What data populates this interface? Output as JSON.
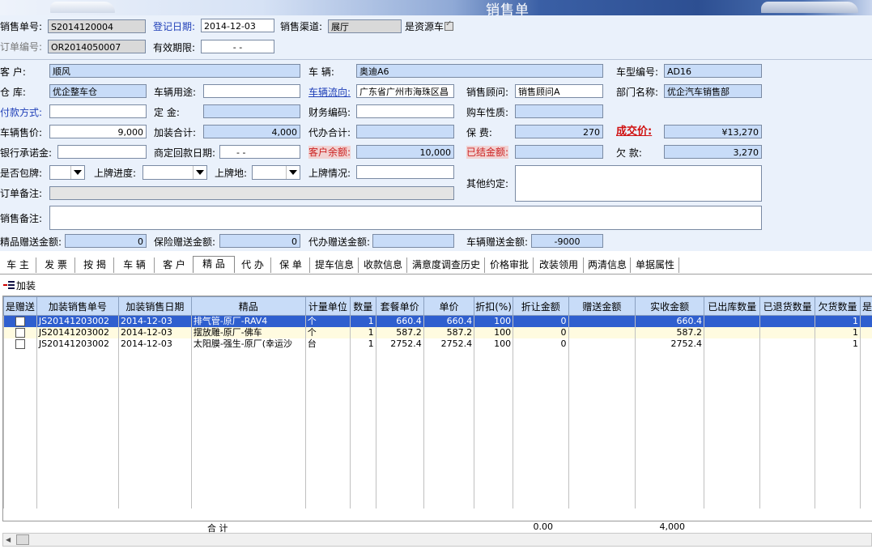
{
  "window": {
    "title": "销售单"
  },
  "header": {
    "sale_no_label": "销售单号:",
    "sale_no": "S2014120004",
    "reg_date_label": "登记日期:",
    "reg_date": "2014-12-03",
    "channel_label": "销售渠道:",
    "channel": "展厅",
    "resource_car_label": "是资源车",
    "order_no_label": "订单编号:",
    "order_no": "OR2014050007",
    "valid_label": "有效期限:",
    "valid": "-  -"
  },
  "form": {
    "customer_label": "客    户:",
    "customer": "顺风",
    "vehicle_label": "车    辆:",
    "vehicle": "奥迪A6",
    "model_no_label": "车型编号:",
    "model_no": "AD16",
    "warehouse_label": "仓    库:",
    "warehouse": "优企整车仓",
    "usage_label": "车辆用途:",
    "usage": "",
    "flow_label": "车辆流向:",
    "flow": "广东省广州市海珠区昌",
    "consultant_label": "销售顾问:",
    "consultant": "销售顾问A",
    "dept_label": "部门名称:",
    "dept": "优企汽车销售部",
    "pay_label": "付款方式:",
    "pay": "",
    "deposit_label": "定    金:",
    "deposit": "",
    "fin_code_label": "财务编码:",
    "fin_code": "",
    "buy_nature_label": "购车性质:",
    "buy_nature": "",
    "price_label": "车辆售价:",
    "price": "9,000",
    "addon_total_label": "加装合计:",
    "addon_total": "4,000",
    "agent_total_label": "代办合计:",
    "agent_total": "",
    "insurance_label": "保    费:",
    "insurance": "270",
    "deal_price_label": "成交价:",
    "deal_price": "¥13,270",
    "bank_label": "银行承诺金:",
    "bank": "",
    "repay_date_label": "商定回款日期:",
    "repay_date": "-  -",
    "cust_balance_label": "客户余额:",
    "cust_balance": "10,000",
    "settled_label": "已结金额:",
    "settled": "",
    "owed_label": "欠    款:",
    "owed": "3,270",
    "plate_pkg_label": "是否包牌:",
    "plate_progress_label": "上牌进度:",
    "plate_place_label": "上牌地:",
    "plate_status_label": "上牌情况:",
    "plate_status": "",
    "other_label": "其他约定:",
    "other": "",
    "order_note_label": "订单备注:",
    "order_note": "",
    "sale_note_label": "销售备注:",
    "sale_note": "",
    "gift_goods_label": "精品赠送金额:",
    "gift_goods": "0",
    "gift_ins_label": "保险赠送金额:",
    "gift_ins": "0",
    "gift_agent_label": "代办赠送金额:",
    "gift_agent": "",
    "gift_car_label": "车辆赠送金额:",
    "gift_car": "-9000"
  },
  "tabs": [
    "车 主",
    "发 票",
    "按 揭",
    "车 辆",
    "客 户",
    "精 品",
    "代 办",
    "保 单",
    "提车信息",
    "收款信息",
    "满意度调查历史",
    "价格审批",
    "改装领用",
    "两清信息",
    "单据属性"
  ],
  "toolbar": {
    "add_label": "加装"
  },
  "table": {
    "columns": [
      "是赠送",
      "加装销售单号",
      "加装销售日期",
      "精品",
      "计量单位",
      "数量",
      "套餐单价",
      "单价",
      "折扣(%)",
      "折让金额",
      "赠送金额",
      "实收金额",
      "已出库数量",
      "已退货数量",
      "欠货数量",
      "是服务"
    ],
    "rows": [
      [
        "JS20141203002",
        "2014-12-03",
        "排气管-原厂-RAV4",
        "个",
        "1",
        "660.4",
        "660.4",
        "100",
        "0",
        "",
        "660.4",
        "",
        "",
        "1"
      ],
      [
        "JS20141203002",
        "2014-12-03",
        "摆放雕-原厂-佛车",
        "个",
        "1",
        "587.2",
        "587.2",
        "100",
        "0",
        "",
        "587.2",
        "",
        "",
        "1"
      ],
      [
        "JS20141203002",
        "2014-12-03",
        "太阳膜-强生-原厂(幸运沙",
        "台",
        "1",
        "2752.4",
        "2752.4",
        "100",
        "0",
        "",
        "2752.4",
        "",
        "",
        "1"
      ]
    ],
    "totals": {
      "label": "合    计",
      "discount": "0.00",
      "received": "4,000"
    }
  }
}
